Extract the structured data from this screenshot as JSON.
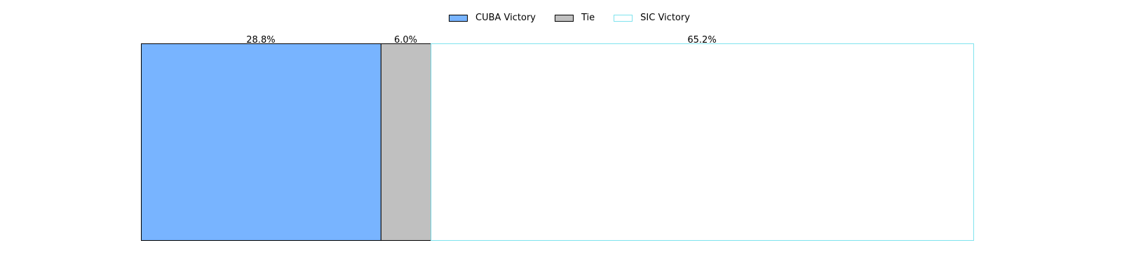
{
  "chart_data": {
    "type": "bar",
    "orientation": "horizontal-stacked-100",
    "series": [
      {
        "name": "CUBA Victory",
        "value": 28.8,
        "label": "28.8%",
        "fill": "#78b4ff",
        "stroke": "#000000"
      },
      {
        "name": "Tie",
        "value": 6.0,
        "label": "6.0%",
        "fill": "#c0c0c0",
        "stroke": "#000000"
      },
      {
        "name": "SIC Victory",
        "value": 65.2,
        "label": "65.2%",
        "fill": "#ffffff",
        "stroke": "#7fe3ee"
      }
    ],
    "xlim": [
      0,
      100
    ],
    "legend_position": "top-center",
    "axes_visible": false,
    "grid": false
  }
}
